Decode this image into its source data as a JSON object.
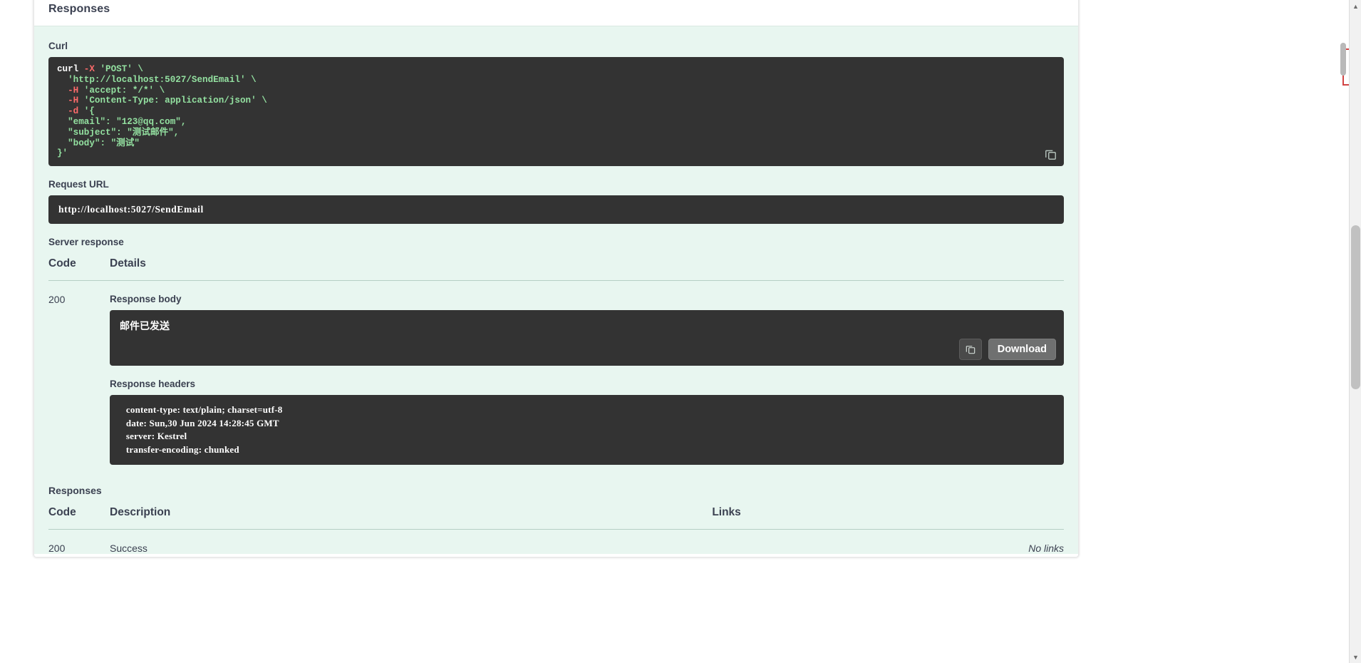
{
  "section": {
    "title": "Responses"
  },
  "curl": {
    "label": "Curl",
    "lines": [
      "curl -X 'POST' \\",
      "  'http://localhost:5027/SendEmail' \\",
      "  -H 'accept: */*' \\",
      "  -H 'Content-Type: application/json' \\",
      "  -d '{",
      "  \"email\": \"123@qq.com\",",
      "  \"subject\": \"测试邮件\",",
      "  \"body\": \"测试\"",
      "}'"
    ],
    "copy_icon": "copy-to-clipboard-icon"
  },
  "request_url": {
    "label": "Request URL",
    "value": "http://localhost:5027/SendEmail"
  },
  "server_response": {
    "label": "Server response",
    "headers": {
      "code": "Code",
      "details": "Details"
    },
    "rows": [
      {
        "code": "200",
        "response_body_label": "Response body",
        "response_body": "邮件已发送",
        "copy_icon": "copy-to-clipboard-icon",
        "download_label": "Download",
        "response_headers_label": "Response headers",
        "response_headers": "  content-type: text/plain; charset=utf-8 \n  date: Sun,30 Jun 2024 14:28:45 GMT \n  server: Kestrel \n  transfer-encoding: chunked "
      }
    ]
  },
  "responses": {
    "label": "Responses",
    "headers": {
      "code": "Code",
      "description": "Description",
      "links": "Links"
    },
    "rows": [
      {
        "code": "200",
        "description": "Success",
        "links": "No links"
      }
    ]
  },
  "scrollbar": {
    "up_arrow": "chevron-up-icon",
    "down_arrow": "chevron-down-icon"
  },
  "colors": {
    "panel_bg": "#e8f6f0",
    "code_bg": "#333333",
    "code_text": "#93e0a0",
    "text": "#3b4151"
  }
}
